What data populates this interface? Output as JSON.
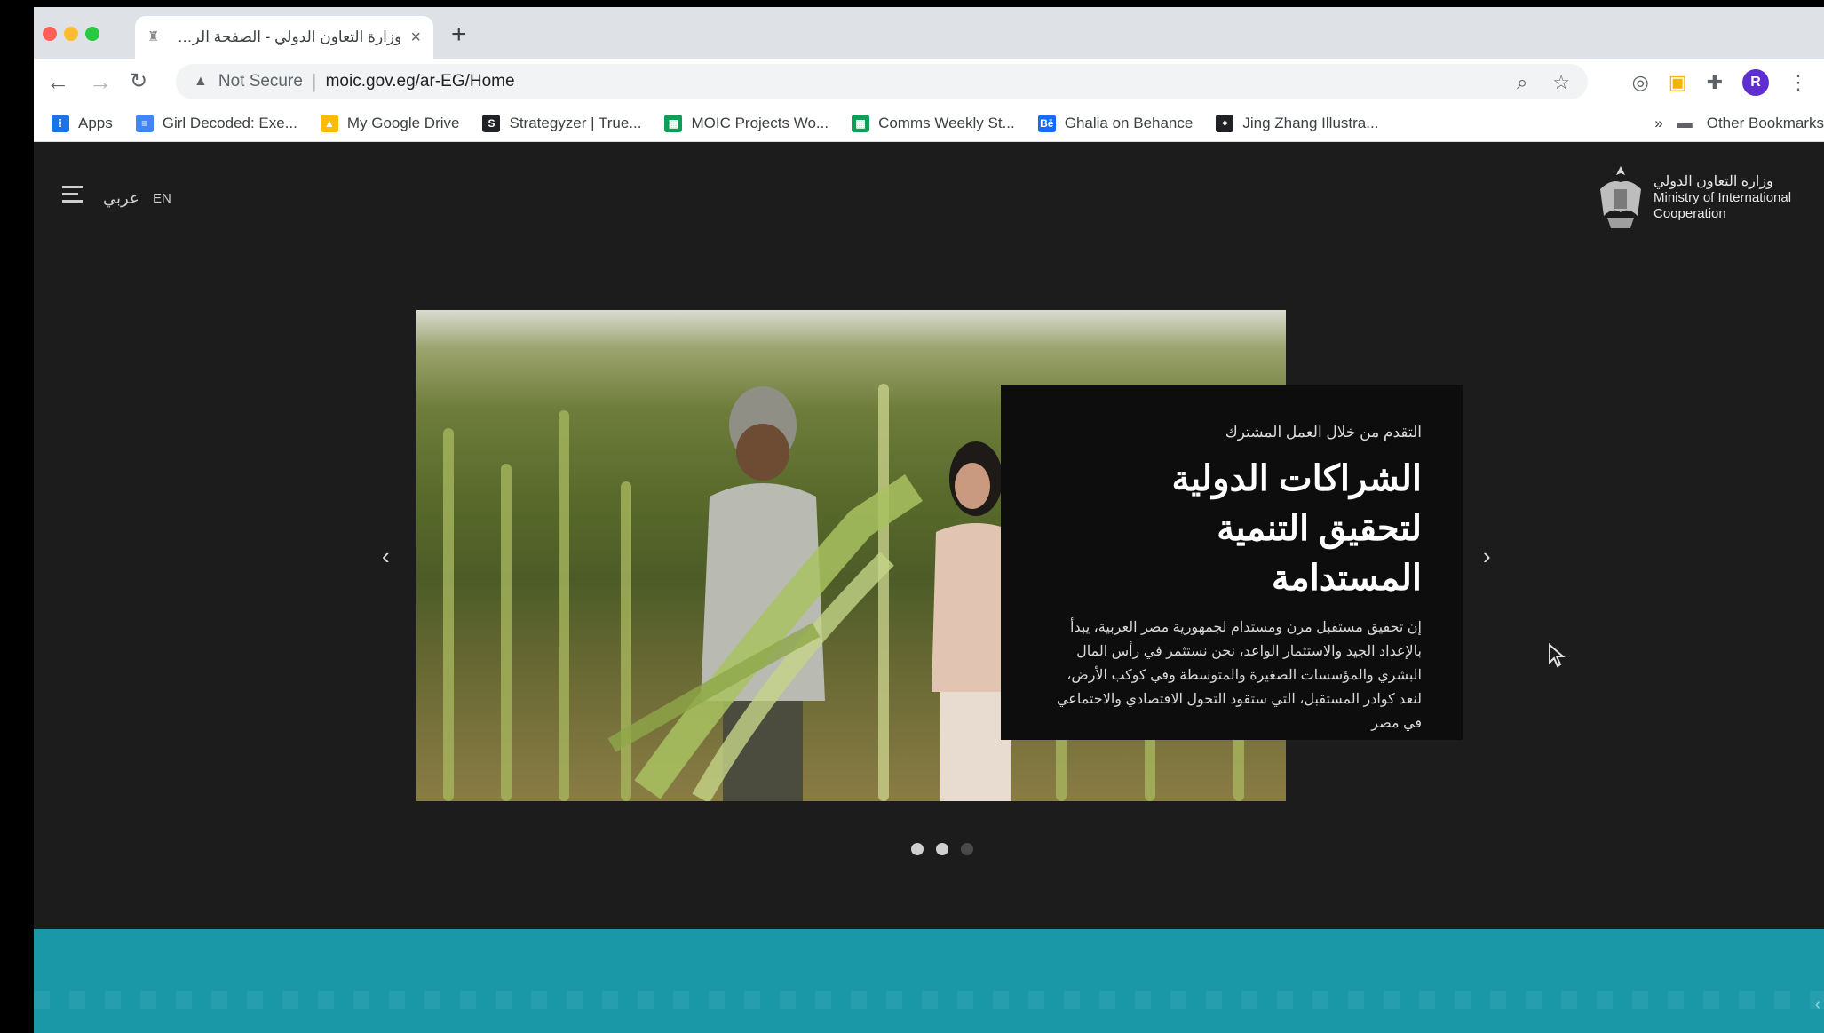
{
  "browser": {
    "tab_title": "وزارة التعاون الدولي - الصفحة الرئ...",
    "new_tab": "+",
    "security_label": "Not Secure",
    "url": "moic.gov.eg/ar-EG/Home",
    "profile_initial": "R"
  },
  "bookmarks": [
    {
      "label": "Apps",
      "icon": "apps-grid-icon",
      "color": "#1a73e8"
    },
    {
      "label": "Girl Decoded: Exe...",
      "icon": "docs-icon",
      "color": "#4285f4"
    },
    {
      "label": "My Google Drive",
      "icon": "drive-icon",
      "color": "#fbbc04"
    },
    {
      "label": "Strategyzer | True...",
      "icon": "strategyzer-icon",
      "color": "#202124"
    },
    {
      "label": "MOIC Projects Wo...",
      "icon": "sheets-icon",
      "color": "#0f9d58"
    },
    {
      "label": "Comms Weekly St...",
      "icon": "sheets-icon",
      "color": "#0f9d58"
    },
    {
      "label": "Ghalia on Behance",
      "icon": "behance-icon",
      "color": "#1769ff"
    },
    {
      "label": "Jing Zhang Illustra...",
      "icon": "star-icon",
      "color": "#202124"
    }
  ],
  "bookmarks_overflow": "»",
  "other_bookmarks": "Other Bookmarks",
  "site": {
    "lang_ar": "عربي",
    "lang_en": "EN",
    "logo_ar": "وزارة التعاون الدولي",
    "logo_en_1": "Ministry of International",
    "logo_en_2": "Cooperation"
  },
  "hero": {
    "kicker": "التقدم من خلال العمل المشترك",
    "title_1": "الشراكات الدولية",
    "title_2": "لتحقيق التنمية",
    "title_3": "المستدامة",
    "body": "إن تحقيق مستقبل مرن ومستدام لجمهورية مصر العربية، يبدأ بالإعداد الجيد والاستثمار الواعد، نحن نستثمر في رأس المال البشري والمؤسسات الصغيرة والمتوسطة وفي كوكب الأرض، لنعد كوادر المستقبل، التي ستقود التحول الاقتصادي والاجتماعي في مصر",
    "prev": "‹",
    "next": "›",
    "slide_count": 3,
    "active_slide": 2
  },
  "colors": {
    "page_bg": "#1c1c1c",
    "caption_bg": "#0d0d0d",
    "teal_band": "#1a98a8"
  }
}
